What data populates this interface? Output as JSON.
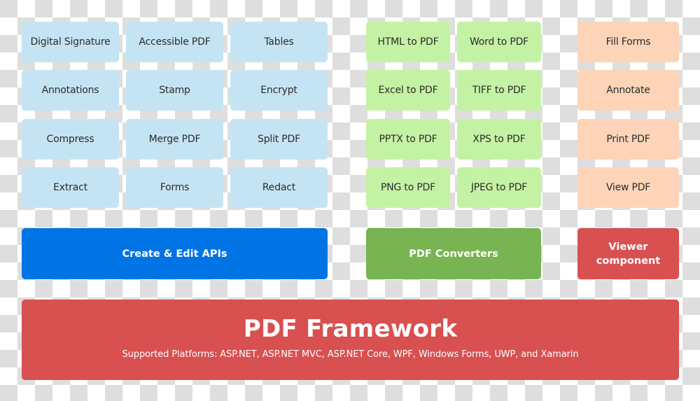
{
  "colors": {
    "feature_blue": "#c5e4f3",
    "converter_green": "#c4f2a4",
    "viewer_orange": "#fdd4b8",
    "create_edit_blue": "#0074e4",
    "converters_green": "#78b452",
    "viewer_red": "#d85050",
    "framework_red": "#d85050"
  },
  "create_edit": {
    "items": [
      "Digital Signature",
      "Accessible PDF",
      "Tables",
      "Annotations",
      "Stamp",
      "Encrypt",
      "Compress",
      "Merge PDF",
      "Split PDF",
      "Extract",
      "Forms",
      "Redact"
    ],
    "label": "Create & Edit APIs"
  },
  "converters": {
    "items": [
      "HTML to PDF",
      "Word to PDF",
      "Excel to PDF",
      "TIFF to PDF",
      "PPTX to PDF",
      "XPS to PDF",
      "PNG to PDF",
      "JPEG to PDF"
    ],
    "label": "PDF Converters"
  },
  "viewer": {
    "items": [
      "Fill Forms",
      "Annotate",
      "Print PDF",
      "View PDF"
    ],
    "label_line1": "Viewer",
    "label_line2": "component"
  },
  "framework": {
    "title": "PDF Framework",
    "subtitle": "Supported Platforms: ASP.NET, ASP.NET MVC, ASP.NET Core, WPF, Windows Forms, UWP, and Xamarin"
  }
}
